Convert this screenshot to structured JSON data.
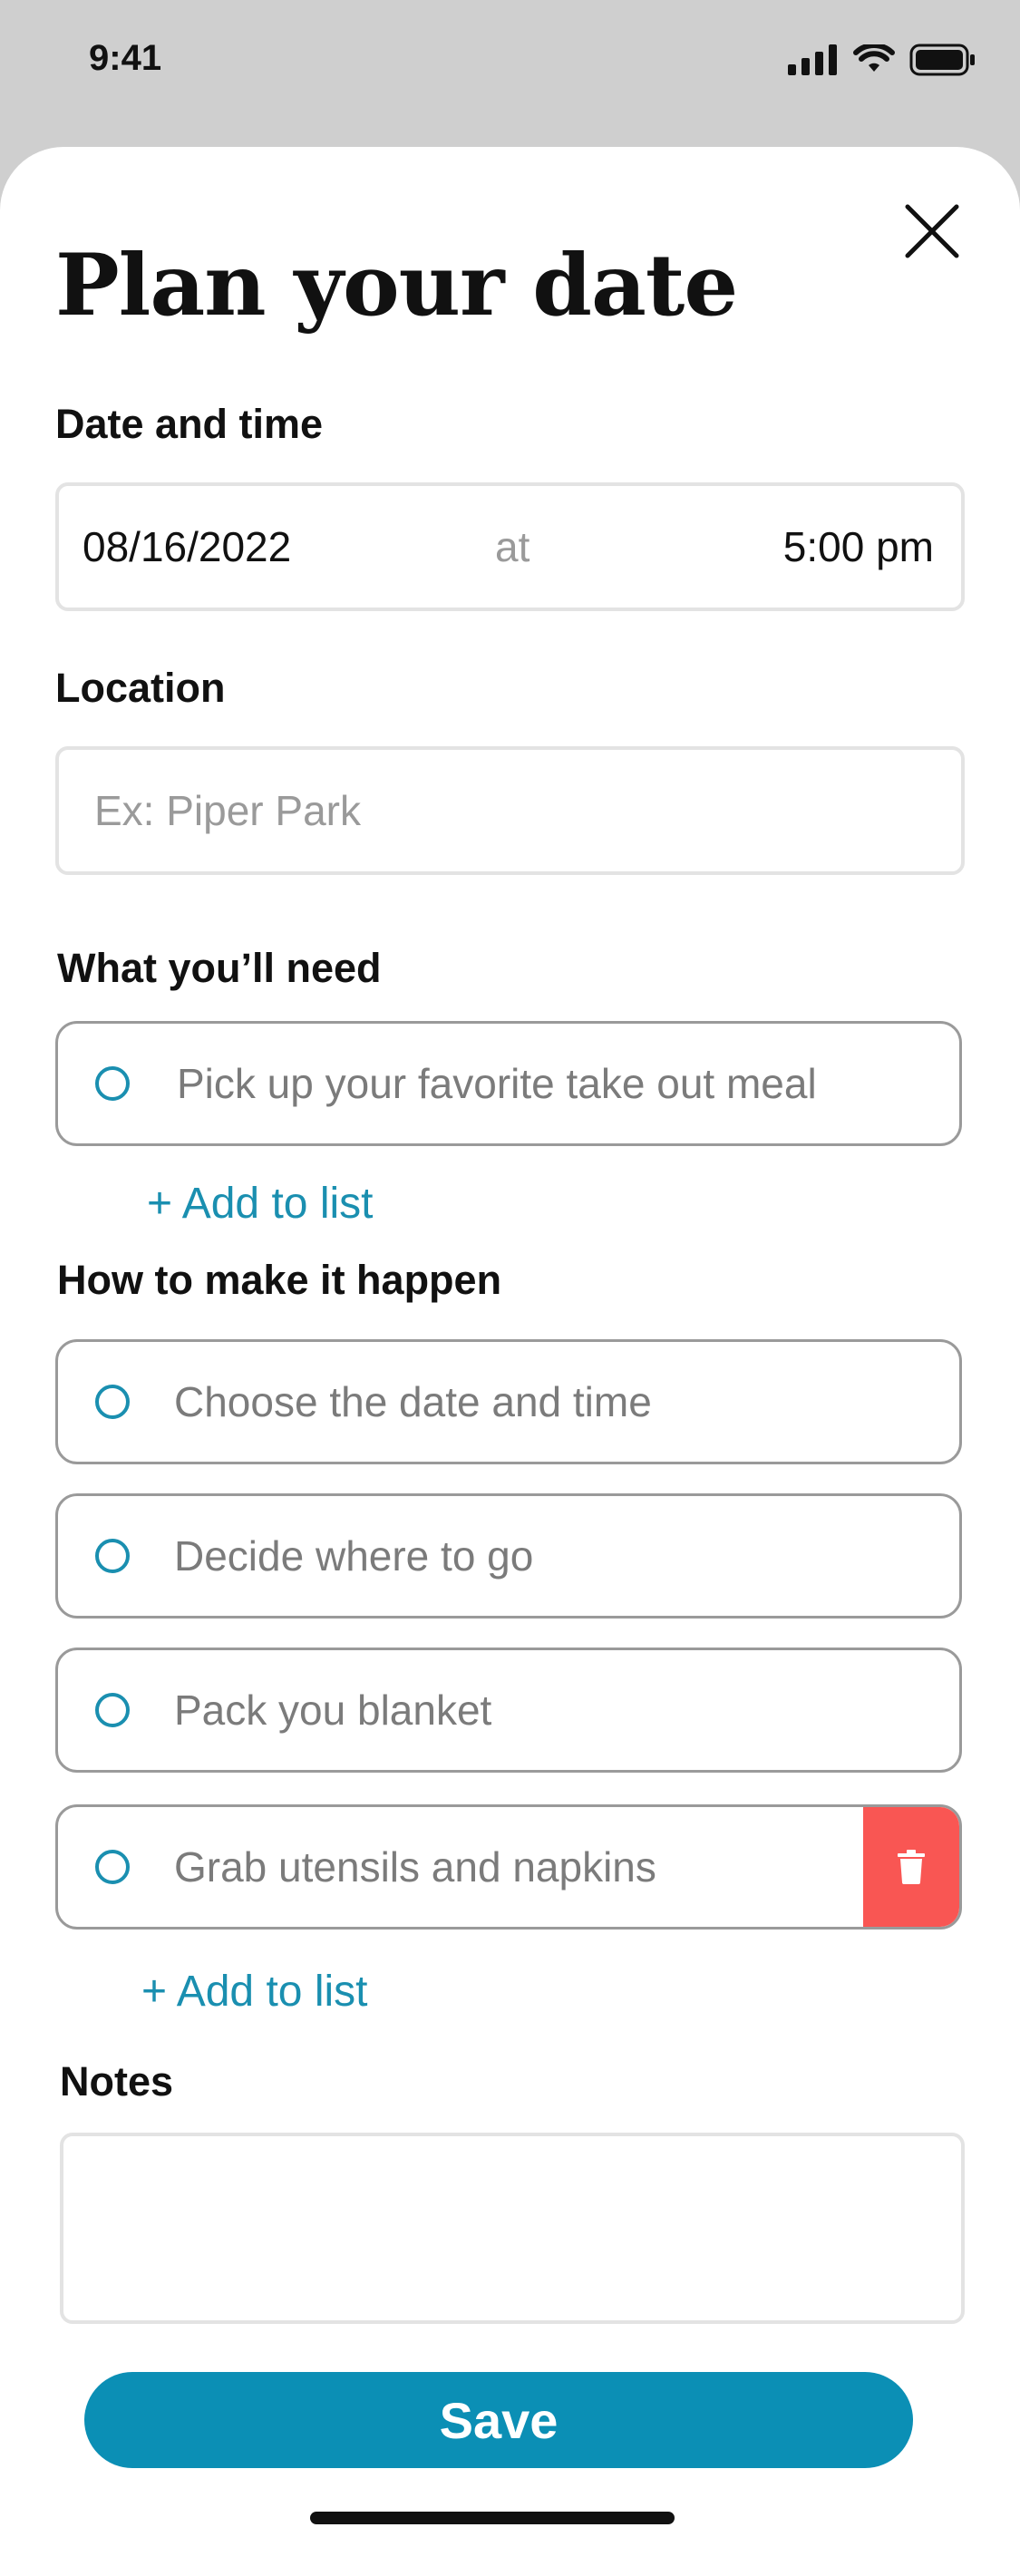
{
  "status_bar": {
    "time": "9:41"
  },
  "header": {
    "title": "Plan your date",
    "close_icon": "close-icon"
  },
  "date_time": {
    "label": "Date and time",
    "date_value": "08/16/2022",
    "separator": "at",
    "time_value": "5:00 pm"
  },
  "location": {
    "label": "Location",
    "placeholder": "Ex: Piper Park"
  },
  "need": {
    "label": "What you’ll need",
    "items": [
      {
        "text": "Pick up your favorite take out meal"
      }
    ],
    "add_label": "+ Add to list"
  },
  "how": {
    "label": "How to make it happen",
    "items": [
      {
        "text": "Choose the date and time"
      },
      {
        "text": "Decide where to go"
      },
      {
        "text": "Pack you blanket"
      },
      {
        "text": "Grab utensils and napkins"
      }
    ],
    "add_label": "+ Add to list"
  },
  "notes": {
    "label": "Notes",
    "value": ""
  },
  "actions": {
    "save_label": "Save"
  },
  "colors": {
    "accent": "#0b8fb5",
    "delete": "#f95653",
    "backdrop": "#cfcfcf"
  }
}
